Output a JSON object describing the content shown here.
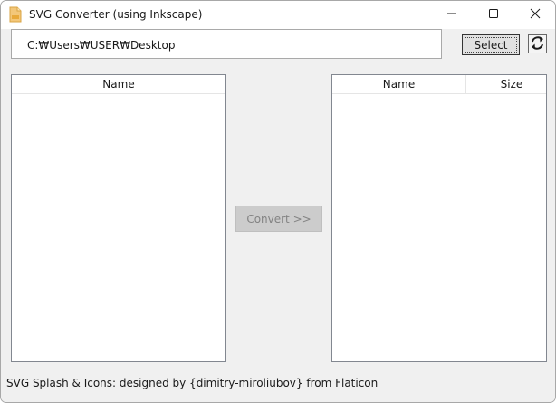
{
  "window": {
    "title": "SVG Converter (using Inkscape)",
    "app_icon": "document-svg-icon",
    "controls": {
      "minimize_icon": "minimize-icon",
      "maximize_icon": "maximize-icon",
      "close_icon": "close-icon"
    }
  },
  "toolbar": {
    "path_value": "C:₩Users₩USER₩Desktop",
    "select_label": "Select",
    "refresh_icon": "refresh-icon"
  },
  "source_list": {
    "columns": [
      "Name"
    ],
    "rows": []
  },
  "convert_button": {
    "label": "Convert >>",
    "enabled": false
  },
  "output_list": {
    "columns": [
      "Name",
      "Size"
    ],
    "rows": []
  },
  "footer": {
    "credit": "SVG Splash & Icons: designed by {dimitry-miroliubov} from Flaticon"
  },
  "colors": {
    "window_bg": "#f0f0f0",
    "titlebar_bg": "#ffffff",
    "disabled_button_bg": "#cccccc",
    "disabled_text": "#838383"
  }
}
